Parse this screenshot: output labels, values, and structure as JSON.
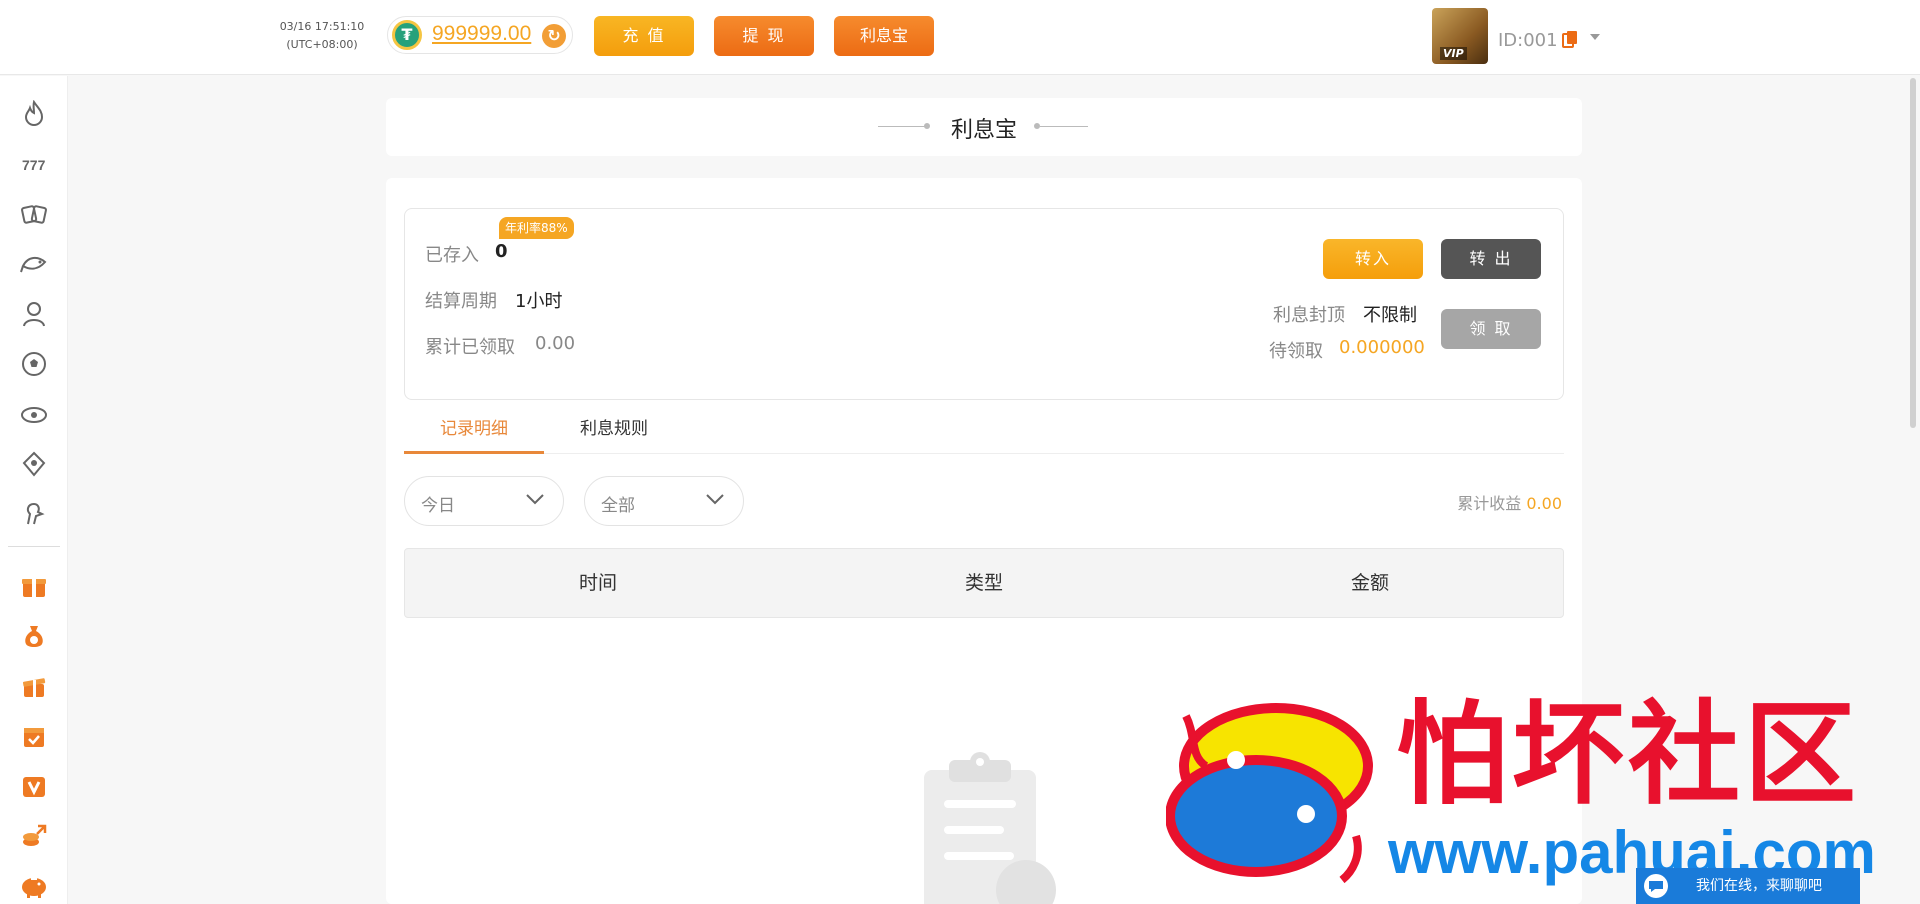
{
  "header": {
    "clock_date": "03/16 17:51:10",
    "clock_tz": "(UTC+08:00)",
    "balance": "999999.00",
    "currency_icon": "tether-icon",
    "recharge_label": "充 值",
    "withdraw_label": "提 现",
    "lxb_label": "利息宝",
    "user_id": "ID:001",
    "vip_badge": "VIP"
  },
  "sidebar": {
    "items": [
      "hot-icon",
      "slots-icon",
      "poker-icon",
      "fishing-icon",
      "live-casino-icon",
      "sports-icon",
      "esports-icon",
      "lottery-icon",
      "cockfight-icon",
      "gift-icon",
      "money-bag-icon",
      "promotion-icon",
      "task-icon",
      "vip-icon",
      "rebate-icon",
      "piggy-bank-icon"
    ]
  },
  "page": {
    "title": "利息宝"
  },
  "summary": {
    "deposited_label": "已存入",
    "deposited_value": "0",
    "annual_rate": "年利率88%",
    "period_label": "结算周期",
    "period_value": "1小时",
    "claimed_label": "累计已领取",
    "claimed_value": "0.00",
    "cap_label": "利息封顶",
    "cap_value": "不限制",
    "pending_label": "待领取",
    "pending_value": "0.000000",
    "transfer_in_label": "转入",
    "transfer_out_label": "转 出",
    "claim_label": "领 取"
  },
  "tabs": [
    {
      "label": "记录明细",
      "active": true
    },
    {
      "label": "利息规则",
      "active": false
    }
  ],
  "filters": {
    "date_value": "今日",
    "type_value": "全部",
    "total_profit_label": "累计收益",
    "total_profit_value": "0.00"
  },
  "table": {
    "columns": [
      "时间",
      "类型",
      "金额"
    ]
  },
  "watermark": {
    "title": "怕坏社区",
    "url": "www.pahuai.com"
  },
  "chat": {
    "label": "我们在线，来聊聊吧"
  },
  "colors": {
    "accent_orange": "#f5a623",
    "deep_orange": "#ec6b14",
    "tab_active": "#e8883a"
  }
}
